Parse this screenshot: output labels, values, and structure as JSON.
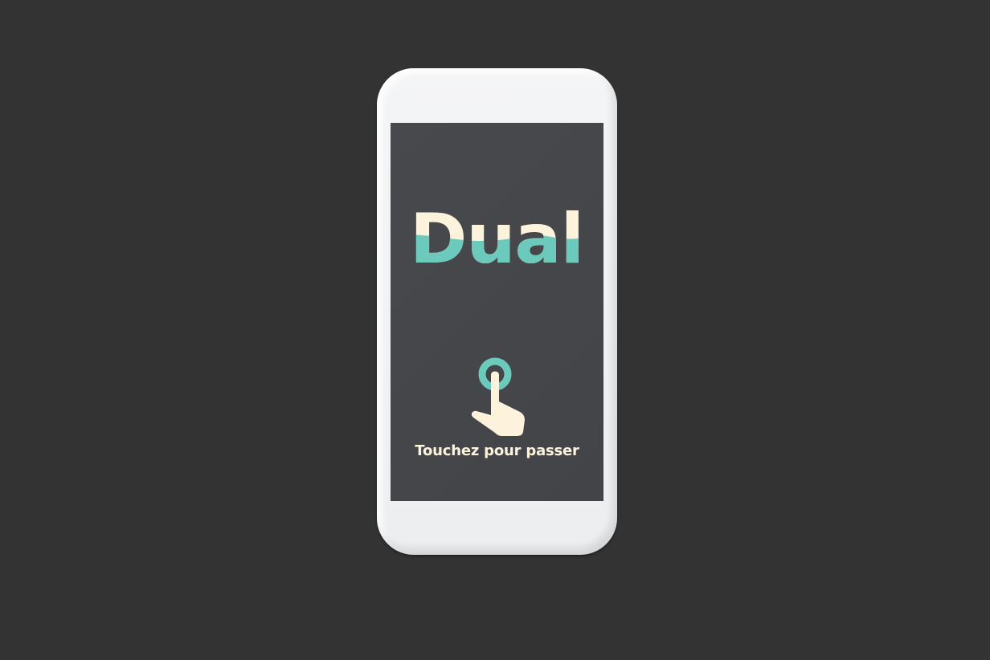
{
  "app": {
    "logo_text": "Dual",
    "hint_label": "Touchez pour passer"
  },
  "icons": {
    "touch": "tap-hand-icon"
  },
  "colors": {
    "background": "#333333",
    "screen": "#45474a",
    "cream": "#fdf3dc",
    "teal": "#6ccabc"
  }
}
